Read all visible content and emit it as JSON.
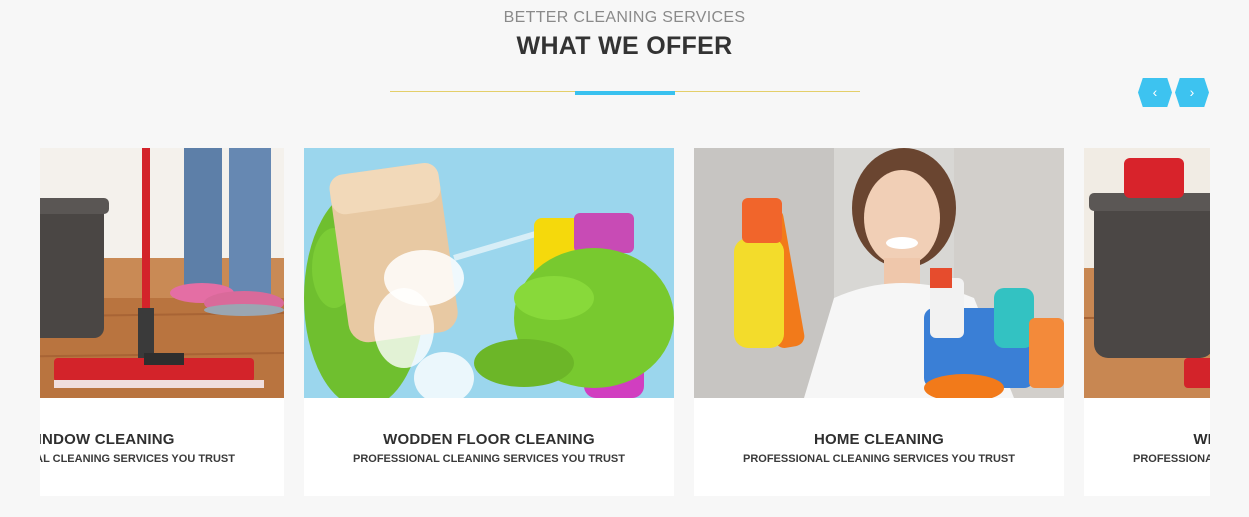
{
  "section": {
    "subtitle": "BETTER CLEANING SERVICES",
    "title": "WHAT WE OFFER"
  },
  "nav": {
    "prev_label": "‹",
    "next_label": "›"
  },
  "colors": {
    "accent": "#39c1ef",
    "divider": "#e4cf6a",
    "background": "#f7f7f7"
  },
  "services": [
    {
      "title": "WINDOW CLEANING",
      "subtitle": "PROFESSIONAL CLEANING SERVICES YOU TRUST",
      "image": "mop-floor-photo"
    },
    {
      "title": "WODDEN FLOOR CLEANING",
      "subtitle": "PROFESSIONAL CLEANING SERVICES YOU TRUST",
      "image": "sponge-spray-photo"
    },
    {
      "title": "HOME CLEANING",
      "subtitle": "PROFESSIONAL CLEANING SERVICES YOU TRUST",
      "image": "woman-cleaning-supplies-photo"
    },
    {
      "title": "WINDOW CLEANING",
      "subtitle": "PROFESSIONAL CLEANING SERVICES YOU TRUST",
      "image": "bucket-mop-photo"
    }
  ]
}
